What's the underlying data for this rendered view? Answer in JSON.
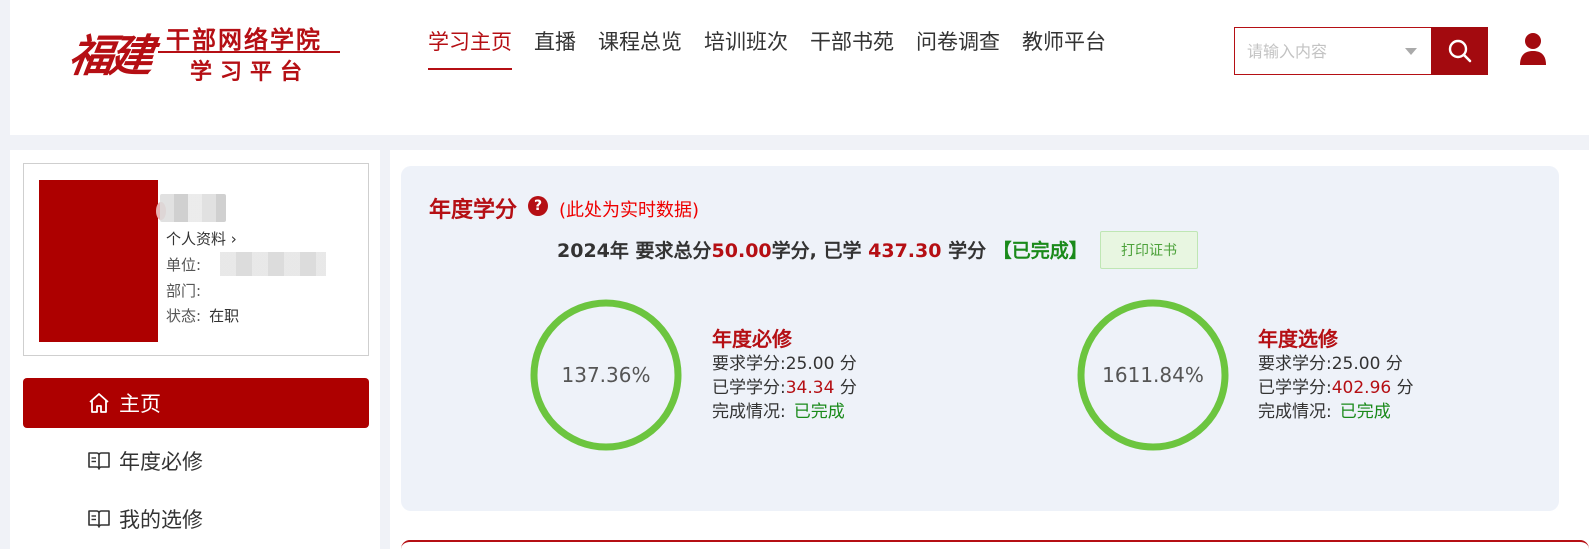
{
  "logo": {
    "calligraphy": "福建",
    "line1": "干部网络学院",
    "line2": "学习平台"
  },
  "nav": {
    "items": [
      "学习主页",
      "直播",
      "课程总览",
      "培训班次",
      "干部书苑",
      "问卷调查",
      "教师平台"
    ],
    "active_index": 0
  },
  "search": {
    "placeholder": "请输入内容",
    "button_icon": "search-icon"
  },
  "header_right": {
    "icon": "user-icon"
  },
  "profile": {
    "link": "个人资料 ›",
    "unit_label": "单位:",
    "dept_label": "部门:",
    "status_label": "状态:",
    "status_value": "在职"
  },
  "sidebar_menu": {
    "items": [
      {
        "label": "主页",
        "icon": "home-icon",
        "active": true
      },
      {
        "label": "年度必修",
        "icon": "book-icon",
        "active": false
      },
      {
        "label": "我的选修",
        "icon": "book-icon",
        "active": false
      }
    ]
  },
  "annual": {
    "title": "年度学分",
    "help_icon": "question-icon",
    "note": "(此处为实时数据)",
    "year": "2024年",
    "required_label": "要求总分",
    "required_value": "50.00",
    "unit_after_required": "学分,",
    "learned_label": "已学",
    "learned_value": "437.30",
    "unit_after_learned": "学分",
    "status": "【已完成】",
    "print_button": "打印证书"
  },
  "required_course": {
    "percent_label": "137.36%",
    "progress": 1.0,
    "title": "年度必修",
    "req_label": "要求学分:",
    "req_value": "25.00 分",
    "learned_label": "已学学分:",
    "learned_value": "34.34",
    "learned_unit": "分",
    "status_label": "完成情况:",
    "status_value": "已完成"
  },
  "elective_course": {
    "percent_label": "1611.84%",
    "progress": 1.0,
    "title": "年度选修",
    "req_label": "要求学分:",
    "req_value": "25.00 分",
    "learned_label": "已学学分:",
    "learned_value": "402.96",
    "learned_unit": "分",
    "status_label": "完成情况:",
    "status_value": "已完成"
  },
  "colors": {
    "brand": "#b50f14",
    "accent_sidebar": "#ad0000",
    "ring": "#6cc53f",
    "complete_green": "#1a8a1a"
  }
}
